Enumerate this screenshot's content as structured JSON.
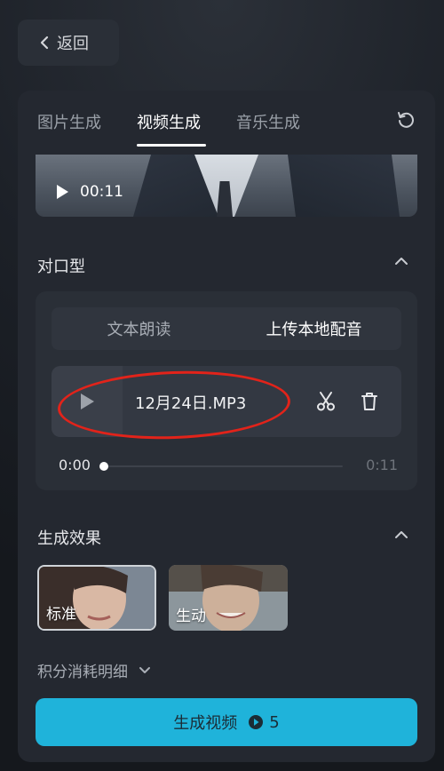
{
  "back": {
    "label": "返回"
  },
  "tabs": [
    {
      "label": "图片生成"
    },
    {
      "label": "视频生成"
    },
    {
      "label": "音乐生成"
    }
  ],
  "active_tab": "视频生成",
  "video_preview": {
    "duration": "00:11"
  },
  "lipsync": {
    "title": "对口型",
    "modes": [
      {
        "label": "文本朗读"
      },
      {
        "label": "上传本地配音"
      }
    ],
    "active_mode": "上传本地配音",
    "file_name": "12月24日.MP3",
    "time_current": "0:00",
    "time_total": "0:11",
    "progress": 0
  },
  "effects": {
    "title": "生成效果",
    "items": [
      {
        "label": "标准",
        "selected": true
      },
      {
        "label": "生动",
        "selected": false
      }
    ]
  },
  "cost_details": {
    "label": "积分消耗明细"
  },
  "generate": {
    "label": "生成视频",
    "credits": "5"
  },
  "colors": {
    "accent": "#1fb3da",
    "annotation": "#e2231a"
  },
  "icons": [
    "chevron-left-icon",
    "reset-icon",
    "play-icon",
    "chevron-up-icon",
    "scissors-icon",
    "trash-icon",
    "chevron-down-icon",
    "credit-icon"
  ]
}
